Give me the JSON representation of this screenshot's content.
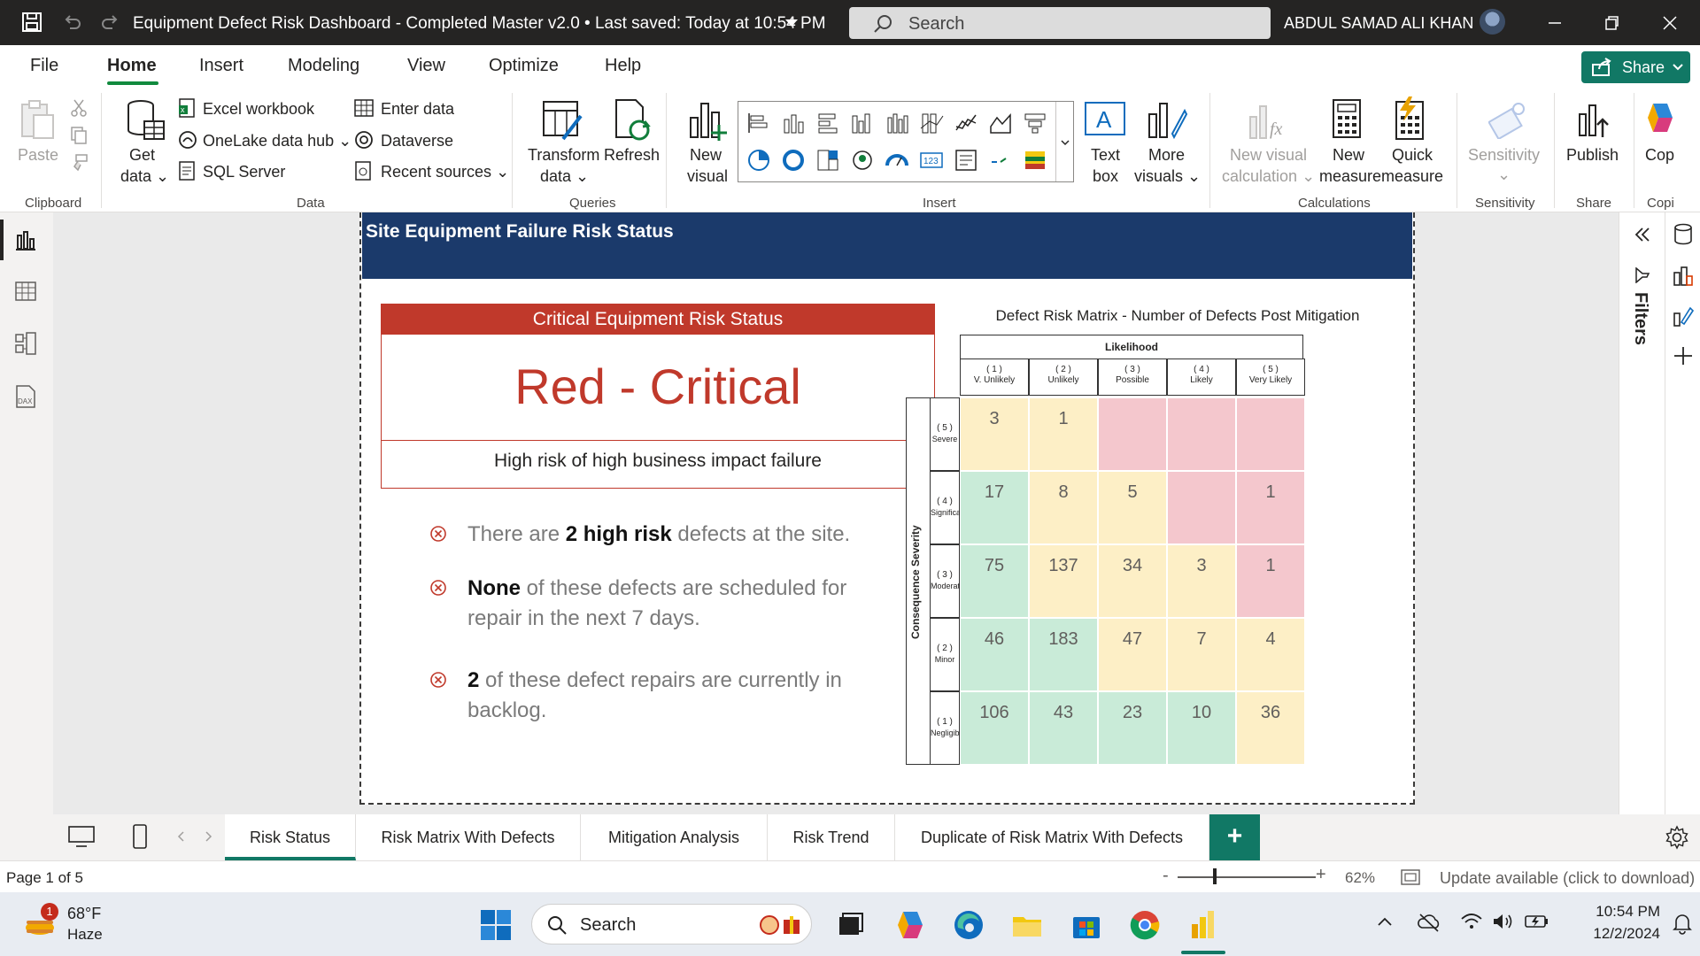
{
  "window": {
    "title": "Equipment Defect Risk Dashboard - Completed Master v2.0  •  Last saved: Today at 10:54 PM",
    "search_placeholder": "Search",
    "user": "ABDUL SAMAD ALI KHAN"
  },
  "menu": {
    "items": [
      "File",
      "Home",
      "Insert",
      "Modeling",
      "View",
      "Optimize",
      "Help"
    ],
    "active": "Home",
    "share": "Share"
  },
  "ribbon": {
    "clipboard": {
      "paste": "Paste",
      "group": "Clipboard"
    },
    "data": {
      "get_data": [
        "Get",
        "data"
      ],
      "excel": "Excel workbook",
      "onelake": "OneLake data hub",
      "sql": "SQL Server",
      "enter_data": "Enter data",
      "dataverse": "Dataverse",
      "recent": "Recent sources",
      "group": "Data"
    },
    "queries": {
      "transform": [
        "Transform",
        "data"
      ],
      "refresh": "Refresh",
      "group": "Queries"
    },
    "insert": {
      "new_visual": [
        "New",
        "visual"
      ],
      "text_box": [
        "Text",
        "box"
      ],
      "more_visuals": [
        "More",
        "visuals"
      ],
      "group": "Insert"
    },
    "calculations": {
      "new_visual_calc": [
        "New visual",
        "calculation"
      ],
      "new_measure": [
        "New",
        "measure"
      ],
      "quick_measure": [
        "Quick",
        "measure"
      ],
      "group": "Calculations"
    },
    "sensitivity": {
      "label": "Sensitivity",
      "group": "Sensitivity"
    },
    "share": {
      "publish": "Publish",
      "group": "Share"
    },
    "copilot": {
      "label": "Cop",
      "group": "Copi"
    }
  },
  "report": {
    "header_title": "Site Equipment Failure Risk Status",
    "status_card": {
      "header": "Critical Equipment Risk Status",
      "value": "Red - Critical",
      "subtitle": "High risk of high business impact failure",
      "color": "#c0392b"
    },
    "bullets": [
      {
        "pre": "There are ",
        "bold": "2 high risk",
        "post": " defects at the site."
      },
      {
        "pre": "",
        "bold": "None",
        "post": " of these defects are scheduled for repair in the next 7 days."
      },
      {
        "pre": "",
        "bold": "2",
        "post": " of these defect repairs are currently in backlog."
      }
    ],
    "matrix": {
      "title": "Defect Risk Matrix - Number of Defects Post Mitigation",
      "col_group": "Likelihood",
      "row_group": "Consequence Severity",
      "columns": [
        {
          "num": "( 1 )",
          "label": "V. Unlikely"
        },
        {
          "num": "( 2 )",
          "label": "Unlikely"
        },
        {
          "num": "( 3 )",
          "label": "Possible"
        },
        {
          "num": "( 4 )",
          "label": "Likely"
        },
        {
          "num": "( 5 )",
          "label": "Very Likely"
        }
      ],
      "rows": [
        {
          "num": "( 5 )",
          "label": "Severe",
          "cells": [
            [
              "3",
              "yellow"
            ],
            [
              "1",
              "yellow"
            ],
            [
              "",
              "red"
            ],
            [
              "",
              "red"
            ],
            [
              "",
              "red"
            ]
          ]
        },
        {
          "num": "( 4 )",
          "label": "Significant",
          "cells": [
            [
              "17",
              "green"
            ],
            [
              "8",
              "yellow"
            ],
            [
              "5",
              "yellow"
            ],
            [
              "",
              "red"
            ],
            [
              "1",
              "red"
            ]
          ]
        },
        {
          "num": "( 3 )",
          "label": "Moderate",
          "cells": [
            [
              "75",
              "green"
            ],
            [
              "137",
              "yellow"
            ],
            [
              "34",
              "yellow"
            ],
            [
              "3",
              "yellow"
            ],
            [
              "1",
              "red"
            ]
          ]
        },
        {
          "num": "( 2 )",
          "label": "Minor",
          "cells": [
            [
              "46",
              "green"
            ],
            [
              "183",
              "green"
            ],
            [
              "47",
              "yellow"
            ],
            [
              "7",
              "yellow"
            ],
            [
              "4",
              "yellow"
            ]
          ]
        },
        {
          "num": "( 1 )",
          "label": "Negligible",
          "cells": [
            [
              "106",
              "green"
            ],
            [
              "43",
              "green"
            ],
            [
              "23",
              "green"
            ],
            [
              "10",
              "green"
            ],
            [
              "36",
              "yellow"
            ]
          ]
        }
      ]
    }
  },
  "filters_label": "Filters",
  "tabs": [
    "Risk Status",
    "Risk Matrix With Defects",
    "Mitigation Analysis",
    "Risk Trend",
    "Duplicate of Risk Matrix With Defects"
  ],
  "active_tab": "Risk Status",
  "status": {
    "page": "Page 1 of 5",
    "zoom": "62%",
    "update": "Update available (click to download)"
  },
  "taskbar": {
    "weather_badge": "1",
    "temp": "68°F",
    "weather": "Haze",
    "search": "Search",
    "time": "10:54 PM",
    "date": "12/2/2024"
  }
}
